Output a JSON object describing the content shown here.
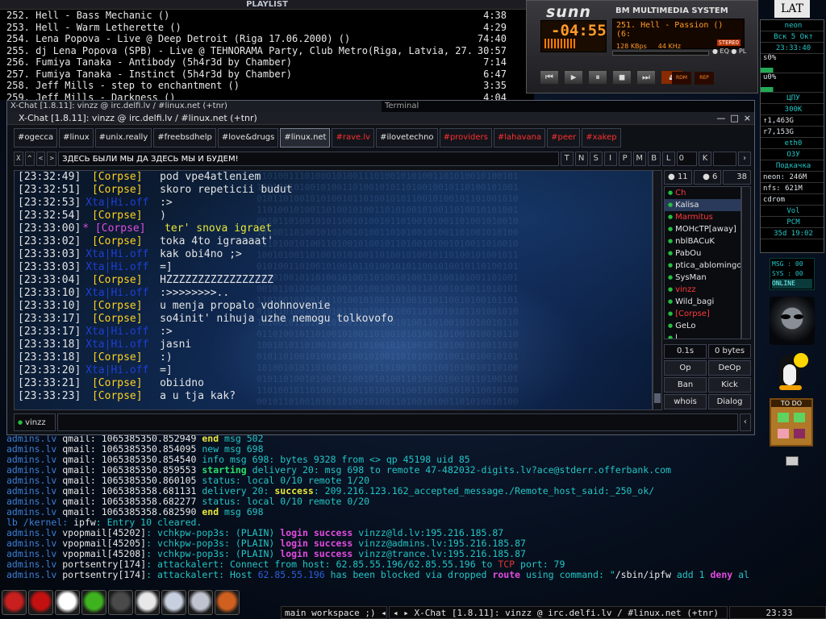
{
  "playlist": {
    "title": "PLAYLIST",
    "items": [
      {
        "title": "252. Hell - Bass Mechanic ()",
        "dur": "4:38"
      },
      {
        "title": "253. Hell - Warm Letherette ()",
        "dur": "4:29"
      },
      {
        "title": "254. Lena Popova - Live @ Deep Detroit (Riga 17.06.2000) ()",
        "dur": "74:40"
      },
      {
        "title": "255. dj Lena Popova (SPB) - Live @ TEHNORAMA Party, Club Metro(Riga, Latvia, 27...",
        "dur": "30:57"
      },
      {
        "title": "256. Fumiya Tanaka - Antibody (5h4r3d by Chamber)",
        "dur": "7:14"
      },
      {
        "title": "257. Fumiya Tanaka - Instinct (5h4r3d by Chamber)",
        "dur": "6:47"
      },
      {
        "title": "258. Jeff Mills - step to enchantment ()",
        "dur": "3:35"
      },
      {
        "title": "259. Jeff Mills - Darkness ()",
        "dur": "4:04"
      }
    ]
  },
  "player": {
    "logo": "sunn",
    "system_name": "BM MULTIMEDIA SYSTEM",
    "time": "-04:55",
    "song": "251. Hell - Passion () (6:",
    "kbps": "128 KBps",
    "khz": "44 KHz",
    "stereo": "STEREO",
    "eq": "EQ",
    "pl": "PL",
    "rdm": "RDM",
    "rep": "REP"
  },
  "xchat": {
    "outer_title": "X-Chat [1.8.11]: vinzz @ irc.delfi.lv / #linux.net (+tnr)",
    "outer_title_right": "Terminal",
    "window_title": "X-Chat [1.8.11]: vinzz @ irc.delfi.lv / #linux.net (+tnr)",
    "window_buttons": [
      "—",
      "□",
      "×"
    ],
    "tabs": [
      {
        "label": "#ogecca",
        "state": "normal"
      },
      {
        "label": "#linux",
        "state": "normal"
      },
      {
        "label": "#unix.really",
        "state": "normal"
      },
      {
        "label": "#freebsdhelp",
        "state": "normal"
      },
      {
        "label": "#love&drugs",
        "state": "normal"
      },
      {
        "label": "#linux.net",
        "state": "active"
      },
      {
        "label": "#rave.lv",
        "state": "alert"
      },
      {
        "label": "#ilovetechno",
        "state": "normal"
      },
      {
        "label": "#providers",
        "state": "alert"
      },
      {
        "label": "#lahavana",
        "state": "alert"
      },
      {
        "label": "#peer",
        "state": "alert"
      },
      {
        "label": "#xakep",
        "state": "alert"
      }
    ],
    "nav_buttons": [
      "X",
      "^",
      "<",
      ">"
    ],
    "topic": "ЗДЕСЬ БЫЛИ МЫ ДА ЗДЕСЬ МЫ И БУДЕМ!",
    "mode_buttons": [
      "T",
      "N",
      "S",
      "I",
      "P",
      "M",
      "B",
      "L"
    ],
    "limit_value": "0",
    "key_label": "K",
    "messages": [
      {
        "time": "[23:32:49]",
        "nick": "[Corpse]",
        "text": "pod vpe4atleniem",
        "kind": "normal"
      },
      {
        "time": "[23:32:51]",
        "nick": "[Corpse]",
        "text": "skoro repeticii budut",
        "kind": "normal"
      },
      {
        "time": "[23:32:53]",
        "nick": "Xta|Hi.off",
        "text": ":>",
        "kind": "blue"
      },
      {
        "time": "[23:32:54]",
        "nick": "[Corpse]",
        "text": ")",
        "kind": "normal"
      },
      {
        "time": "[23:33:00]",
        "nick": "* [Corpse]",
        "text": "ter' snova igraet",
        "kind": "action"
      },
      {
        "time": "[23:33:02]",
        "nick": "[Corpse]",
        "text": "toka 4to igraaaat'",
        "kind": "normal"
      },
      {
        "time": "[23:33:03]",
        "nick": "Xta|Hi.off",
        "text": "kak obi4no ;>",
        "kind": "blue"
      },
      {
        "time": "[23:33:03]",
        "nick": "Xta|Hi.off",
        "text": "=]",
        "kind": "blue"
      },
      {
        "time": "[23:33:04]",
        "nick": "[Corpse]",
        "text": "HZZZZZZZZZZZZZZZZZ",
        "kind": "normal"
      },
      {
        "time": "[23:33:10]",
        "nick": "Xta|Hi.off",
        "text": ":>>>>>>>>..",
        "kind": "blue"
      },
      {
        "time": "[23:33:10]",
        "nick": "[Corpse]",
        "text": "u menja propalo vdohnovenie",
        "kind": "normal"
      },
      {
        "time": "[23:33:17]",
        "nick": "[Corpse]",
        "text": "so4init' nihuja uzhe nemogu tolkovofo",
        "kind": "normal"
      },
      {
        "time": "[23:33:17]",
        "nick": "Xta|Hi.off",
        "text": ":>",
        "kind": "blue"
      },
      {
        "time": "[23:33:18]",
        "nick": "Xta|Hi.off",
        "text": "jasni",
        "kind": "blue"
      },
      {
        "time": "[23:33:18]",
        "nick": "[Corpse]",
        "text": ":)",
        "kind": "normal"
      },
      {
        "time": "[23:33:20]",
        "nick": "Xta|Hi.off",
        "text": "=]",
        "kind": "blue"
      },
      {
        "time": "[23:33:21]",
        "nick": "[Corpse]",
        "text": "obiidno",
        "kind": "normal"
      },
      {
        "time": "[23:33:23]",
        "nick": "[Corpse]",
        "text": "a u tja kak?",
        "kind": "normal"
      }
    ],
    "counts": {
      "ops": "11",
      "voices": "6",
      "total": "38"
    },
    "users": [
      {
        "name": "Ch",
        "color": "red"
      },
      {
        "name": "Kalisa",
        "color": "white",
        "selected": true
      },
      {
        "name": "Marmitus",
        "color": "red"
      },
      {
        "name": "MOHcTP[away]",
        "color": "white"
      },
      {
        "name": "nblBACuK",
        "color": "white"
      },
      {
        "name": "PabOu",
        "color": "white"
      },
      {
        "name": "ptica_ablomingo",
        "color": "white"
      },
      {
        "name": "SysMan",
        "color": "white"
      },
      {
        "name": "vinzz",
        "color": "red"
      },
      {
        "name": "Wild_bagi",
        "color": "white"
      },
      {
        "name": "[Corpse]",
        "color": "red"
      },
      {
        "name": "GeLo",
        "color": "white"
      },
      {
        "name": "l",
        "color": "white"
      }
    ],
    "lag": "0.1s",
    "throughput": "0 bytes",
    "user_buttons": [
      "Op",
      "DeOp",
      "Ban",
      "Kick",
      "whois",
      "Dialog"
    ],
    "nick": "vinzz",
    "input_value": ""
  },
  "terminal": {
    "lines": [
      [
        {
          "t": "admins.lv ",
          "c": "h"
        },
        {
          "t": "qmail: ",
          "c": "w"
        },
        {
          "t": "1065385350.852949 ",
          "c": "w"
        },
        {
          "t": "end ",
          "c": "y"
        },
        {
          "t": "msg 502",
          "c": "c"
        }
      ],
      [
        {
          "t": "admins.lv ",
          "c": "h"
        },
        {
          "t": "qmail: ",
          "c": "w"
        },
        {
          "t": "1065385350.854095 ",
          "c": "w"
        },
        {
          "t": "new msg 698",
          "c": "c"
        }
      ],
      [
        {
          "t": "admins.lv ",
          "c": "h"
        },
        {
          "t": "qmail: ",
          "c": "w"
        },
        {
          "t": "1065385350.854540 ",
          "c": "w"
        },
        {
          "t": "info msg 698: bytes 9328 from <> qp 45198 uid 85",
          "c": "c"
        }
      ],
      [
        {
          "t": "admins.lv ",
          "c": "h"
        },
        {
          "t": "qmail: ",
          "c": "w"
        },
        {
          "t": "1065385350.859553 ",
          "c": "w"
        },
        {
          "t": "starting ",
          "c": "g"
        },
        {
          "t": "delivery 20: msg 698 to remote 47-482032-digits.lv?ace@stderr.offerbank.com",
          "c": "c"
        }
      ],
      [
        {
          "t": "admins.lv ",
          "c": "h"
        },
        {
          "t": "qmail: ",
          "c": "w"
        },
        {
          "t": "1065385350.860105 ",
          "c": "w"
        },
        {
          "t": "status: local 0/10 remote 1/20",
          "c": "c"
        }
      ],
      [
        {
          "t": "admins.lv ",
          "c": "h"
        },
        {
          "t": "qmail: ",
          "c": "w"
        },
        {
          "t": "1065385358.681131 ",
          "c": "w"
        },
        {
          "t": "delivery 20: ",
          "c": "c"
        },
        {
          "t": "success",
          "c": "y"
        },
        {
          "t": ": 209.216.123.162_accepted_message./Remote_host_said:_250_ok/",
          "c": "c"
        }
      ],
      [
        {
          "t": "admins.lv ",
          "c": "h"
        },
        {
          "t": "qmail: ",
          "c": "w"
        },
        {
          "t": "1065385358.682277 ",
          "c": "w"
        },
        {
          "t": "status: local 0/10 remote 0/20",
          "c": "c"
        }
      ],
      [
        {
          "t": "admins.lv ",
          "c": "h"
        },
        {
          "t": "qmail: ",
          "c": "w"
        },
        {
          "t": "1065385358.682590 ",
          "c": "w"
        },
        {
          "t": "end ",
          "c": "y"
        },
        {
          "t": "msg 698",
          "c": "c"
        }
      ],
      [
        {
          "t": "lb /kernel: ",
          "c": "h"
        },
        {
          "t": "ipfw",
          "c": "w"
        },
        {
          "t": ": Entry 10 cleared.",
          "c": "c"
        }
      ],
      [
        {
          "t": "admins.lv ",
          "c": "h"
        },
        {
          "t": "vpopmail",
          "c": "w"
        },
        {
          "t": "[45202]",
          "c": "w"
        },
        {
          "t": ": vchkpw-pop3s: (PLAIN) ",
          "c": "c"
        },
        {
          "t": "login success ",
          "c": "m"
        },
        {
          "t": "vinzz@ld.lv:195.216.185.87",
          "c": "c"
        }
      ],
      [
        {
          "t": "admins.lv ",
          "c": "h"
        },
        {
          "t": "vpopmail",
          "c": "w"
        },
        {
          "t": "[45205]",
          "c": "w"
        },
        {
          "t": ": vchkpw-pop3s: (PLAIN) ",
          "c": "c"
        },
        {
          "t": "login success ",
          "c": "m"
        },
        {
          "t": "vinzz@admins.lv:195.216.185.87",
          "c": "c"
        }
      ],
      [
        {
          "t": "admins.lv ",
          "c": "h"
        },
        {
          "t": "vpopmail",
          "c": "w"
        },
        {
          "t": "[45208]",
          "c": "w"
        },
        {
          "t": ": vchkpw-pop3s: (PLAIN) ",
          "c": "c"
        },
        {
          "t": "login success ",
          "c": "m"
        },
        {
          "t": "vinzz@trance.lv:195.216.185.87",
          "c": "c"
        }
      ],
      [
        {
          "t": "admins.lv ",
          "c": "h"
        },
        {
          "t": "portsentry",
          "c": "w"
        },
        {
          "t": "[174]",
          "c": "w"
        },
        {
          "t": ": attackalert: Connect from host: 62.85.55.196/62.85.55.196 to ",
          "c": "c"
        },
        {
          "t": "TCP ",
          "c": "r"
        },
        {
          "t": "port: 79",
          "c": "c"
        }
      ],
      [
        {
          "t": "admins.lv ",
          "c": "h"
        },
        {
          "t": "portsentry",
          "c": "w"
        },
        {
          "t": "[174]",
          "c": "w"
        },
        {
          "t": ": attackalert: Host ",
          "c": "c"
        },
        {
          "t": "62.85.55.196 ",
          "c": "b"
        },
        {
          "t": "has been blocked via dropped ",
          "c": "c"
        },
        {
          "t": "route ",
          "c": "m"
        },
        {
          "t": "using command: \"",
          "c": "c"
        },
        {
          "t": "/sbin/ipfw ",
          "c": "w"
        },
        {
          "t": "add 1 ",
          "c": "c"
        },
        {
          "t": "deny ",
          "c": "m"
        },
        {
          "t": "al",
          "c": "c"
        }
      ]
    ]
  },
  "dock": {
    "lang": "LAT",
    "host": "neon",
    "date": "Вск 5 Окт",
    "time": "23:33:40",
    "s0": "s0%",
    "u0": "u0%",
    "cpu": "ЦПУ",
    "freq": "300K",
    "net_in": "↑1,463G",
    "net_out": "r7,153G",
    "iface": "eth0",
    "mem": "ОЗУ",
    "swap": "Подкачка",
    "disk1": "neon: 246M",
    "disk2": "nfs: 621M",
    "cdrom": "cdrom",
    "vol": "Vol",
    "pcm": "PCM",
    "uptime": "35d 19:02",
    "msg": "MSG : 00",
    "sys": "SYS : 00",
    "online": "ONLINE",
    "todo": "TO DO"
  },
  "taskbar": {
    "workspace": "main workspace ;)",
    "active_task": "X-Chat [1.8.11]: vinzz @ irc.delfi.lv / #linux.net (+tnr)",
    "clock": "23:33",
    "apps": [
      "firefox-icon",
      "opera-icon",
      "xchat-icon",
      "gnome-icon",
      "xmms-icon",
      "xroast-icon",
      "eye-icon",
      "mail-icon",
      "apple-icon"
    ]
  }
}
